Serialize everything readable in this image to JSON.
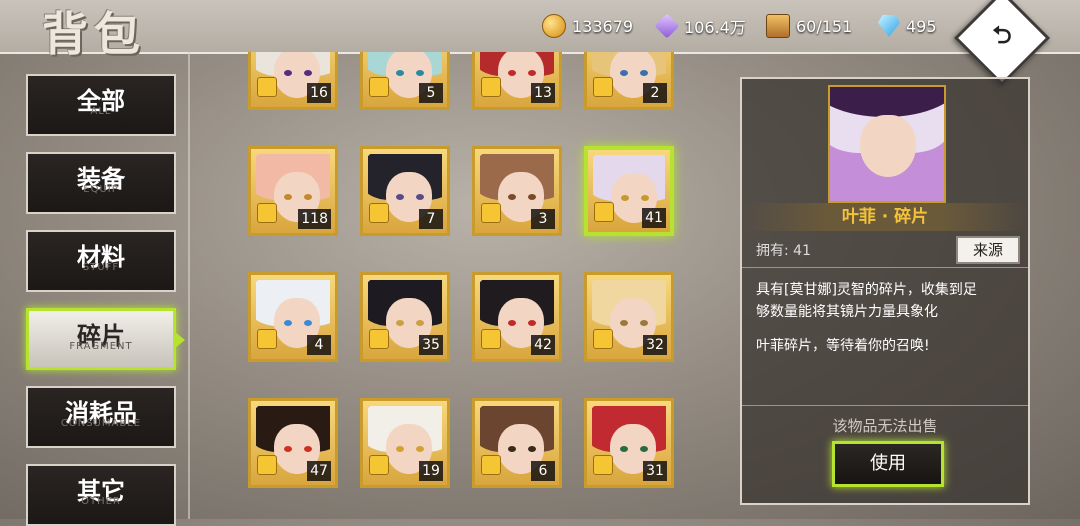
{
  "header": {
    "title": "背包",
    "gold": "133679",
    "crystal": "106.4万",
    "capacity": "60/151",
    "diamonds": "495",
    "back_symbol": "⮌"
  },
  "sidebar": {
    "items": [
      {
        "zh": "全部",
        "en": "ALL"
      },
      {
        "zh": "装备",
        "en": "EQUIP"
      },
      {
        "zh": "材料",
        "en": "STUFF"
      },
      {
        "zh": "碎片",
        "en": "FRAGMENT"
      },
      {
        "zh": "消耗品",
        "en": "CONSUMABLE"
      },
      {
        "zh": "其它",
        "en": "OTHER"
      }
    ]
  },
  "grid": {
    "tiles": [
      {
        "count": "16",
        "hair": "#e9e4dc",
        "eye": "#5a2a80"
      },
      {
        "count": "5",
        "hair": "#a9d7d6",
        "eye": "#2a8aa0"
      },
      {
        "count": "13",
        "hair": "#b52a2a",
        "eye": "#c22a2a"
      },
      {
        "count": "2",
        "hair": "#e6c47a",
        "eye": "#3a6fb0"
      },
      {
        "count": "118",
        "hair": "#f2b9a4",
        "eye": "#c4882e"
      },
      {
        "count": "7",
        "hair": "#24222a",
        "eye": "#5a4a8a"
      },
      {
        "count": "3",
        "hair": "#9a6a4a",
        "eye": "#7a4a2a"
      },
      {
        "count": "41",
        "hair": "#e3d8ec",
        "eye": "#c49a2e"
      },
      {
        "count": "4",
        "hair": "#eceff3",
        "eye": "#3b8ad8"
      },
      {
        "count": "35",
        "hair": "#1d1a22",
        "eye": "#caa040"
      },
      {
        "count": "42",
        "hair": "#1f1b1e",
        "eye": "#c02a2a"
      },
      {
        "count": "32",
        "hair": "#f0d7a0",
        "eye": "#9a7a3a"
      },
      {
        "count": "47",
        "hair": "#2a1a14",
        "eye": "#d03020"
      },
      {
        "count": "19",
        "hair": "#f2efe8",
        "eye": "#d4a030"
      },
      {
        "count": "6",
        "hair": "#6b4530",
        "eye": "#3a2a1a"
      },
      {
        "count": "31",
        "hair": "#c22a32",
        "eye": "#2a6a40"
      }
    ]
  },
  "detail": {
    "item_name": "叶菲 · 碎片",
    "owned_label": "拥有: 41",
    "source_button": "来源",
    "description_line1": "具有[莫甘娜]灵智的碎片，收集到足",
    "description_line2": "够数量能将其镜片力量具象化",
    "flavor": "叶菲碎片，等待着你的召唤!",
    "no_sell": "该物品无法出售",
    "use_button": "使用"
  }
}
